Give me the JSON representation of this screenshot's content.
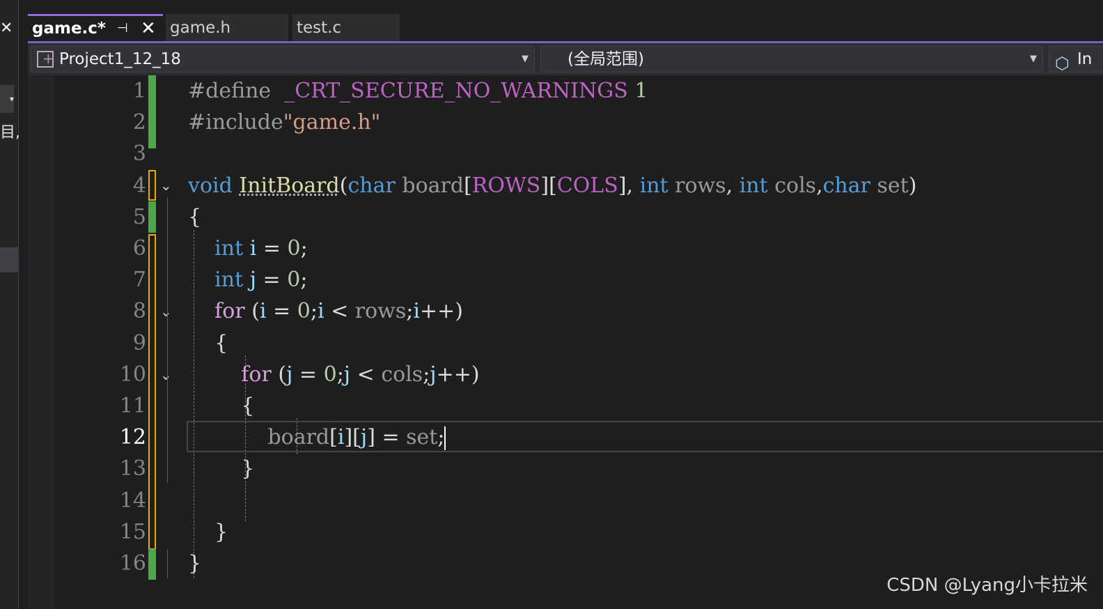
{
  "tabs": [
    {
      "label": "game.c*",
      "active": true
    },
    {
      "label": "game.h",
      "active": false
    },
    {
      "label": "test.c",
      "active": false
    }
  ],
  "tab_icons": {
    "pin": "⊣",
    "close": "✕"
  },
  "navbar": {
    "project": "Project1_12_18",
    "scope": "(全局范围)",
    "member": "In"
  },
  "left_panel": {
    "close": "✕",
    "partial_text": "目,"
  },
  "code_lines": [
    {
      "n": "1",
      "tokens": [
        [
          "pp",
          "#define "
        ],
        [
          "plain",
          " "
        ],
        [
          "mac",
          "_CRT_SECURE_NO_WARNINGS"
        ],
        [
          "plain",
          " "
        ],
        [
          "num",
          "1"
        ]
      ]
    },
    {
      "n": "2",
      "tokens": [
        [
          "pp",
          "#include"
        ],
        [
          "str",
          "\"game.h\""
        ]
      ]
    },
    {
      "n": "3",
      "tokens": []
    },
    {
      "n": "4",
      "tokens": [
        [
          "kw",
          "void"
        ],
        [
          "plain",
          " "
        ],
        [
          "fn",
          "InitBoard"
        ],
        [
          "plain",
          "("
        ],
        [
          "kw",
          "char"
        ],
        [
          "plain",
          " "
        ],
        [
          "param",
          "board"
        ],
        [
          "plain",
          "["
        ],
        [
          "mac",
          "ROWS"
        ],
        [
          "plain",
          "]["
        ],
        [
          "mac",
          "COLS"
        ],
        [
          "plain",
          "], "
        ],
        [
          "kw",
          "int"
        ],
        [
          "plain",
          " "
        ],
        [
          "param",
          "rows"
        ],
        [
          "plain",
          ", "
        ],
        [
          "kw",
          "int"
        ],
        [
          "plain",
          " "
        ],
        [
          "param",
          "cols"
        ],
        [
          "plain",
          ","
        ],
        [
          "kw",
          "char"
        ],
        [
          "plain",
          " "
        ],
        [
          "param",
          "set"
        ],
        [
          "plain",
          ")"
        ]
      ]
    },
    {
      "n": "5",
      "tokens": [
        [
          "plain",
          "{"
        ]
      ]
    },
    {
      "n": "6",
      "tokens": [
        [
          "plain",
          "    "
        ],
        [
          "kw",
          "int"
        ],
        [
          "plain",
          " "
        ],
        [
          "var",
          "i"
        ],
        [
          "plain",
          " = "
        ],
        [
          "num",
          "0"
        ],
        [
          "plain",
          ";"
        ]
      ]
    },
    {
      "n": "7",
      "tokens": [
        [
          "plain",
          "    "
        ],
        [
          "kw",
          "int"
        ],
        [
          "plain",
          " "
        ],
        [
          "var",
          "j"
        ],
        [
          "plain",
          " = "
        ],
        [
          "num",
          "0"
        ],
        [
          "plain",
          ";"
        ]
      ]
    },
    {
      "n": "8",
      "tokens": [
        [
          "plain",
          "    "
        ],
        [
          "ctl",
          "for"
        ],
        [
          "plain",
          " ("
        ],
        [
          "var",
          "i"
        ],
        [
          "plain",
          " = "
        ],
        [
          "num",
          "0"
        ],
        [
          "plain",
          ";"
        ],
        [
          "var",
          "i"
        ],
        [
          "plain",
          " < "
        ],
        [
          "param",
          "rows"
        ],
        [
          "plain",
          ";"
        ],
        [
          "var",
          "i"
        ],
        [
          "plain",
          "++)"
        ]
      ]
    },
    {
      "n": "9",
      "tokens": [
        [
          "plain",
          "    {"
        ]
      ]
    },
    {
      "n": "10",
      "tokens": [
        [
          "plain",
          "        "
        ],
        [
          "ctl",
          "for"
        ],
        [
          "plain",
          " ("
        ],
        [
          "var",
          "j"
        ],
        [
          "plain",
          " = "
        ],
        [
          "num",
          "0"
        ],
        [
          "plain",
          ";"
        ],
        [
          "var",
          "j"
        ],
        [
          "plain",
          " < "
        ],
        [
          "param",
          "cols"
        ],
        [
          "plain",
          ";"
        ],
        [
          "var",
          "j"
        ],
        [
          "plain",
          "++)"
        ]
      ]
    },
    {
      "n": "11",
      "tokens": [
        [
          "plain",
          "        {"
        ]
      ]
    },
    {
      "n": "12",
      "tokens": [
        [
          "plain",
          "            "
        ],
        [
          "param",
          "board"
        ],
        [
          "plain",
          "["
        ],
        [
          "var",
          "i"
        ],
        [
          "plain",
          "]["
        ],
        [
          "var",
          "j"
        ],
        [
          "plain",
          "] = "
        ],
        [
          "param",
          "set"
        ],
        [
          "plain",
          ";"
        ]
      ]
    },
    {
      "n": "13",
      "tokens": [
        [
          "plain",
          "        }"
        ]
      ]
    },
    {
      "n": "14",
      "tokens": []
    },
    {
      "n": "15",
      "tokens": [
        [
          "plain",
          "    }"
        ]
      ]
    },
    {
      "n": "16",
      "tokens": [
        [
          "plain",
          "}"
        ]
      ]
    }
  ],
  "current_line": "12",
  "colors": {
    "keyword": "#569cd6",
    "control": "#d8a0df",
    "macro": "#bd63c5",
    "string": "#d69d85",
    "number": "#b5cea8",
    "function": "#dcdcaa",
    "variable": "#9cdcfe",
    "saved_change": "#4ca64c",
    "unsaved_change": "#e8b000",
    "tab_accent": "#8f6ad8"
  },
  "watermark": "CSDN @Lyang小卡拉米"
}
